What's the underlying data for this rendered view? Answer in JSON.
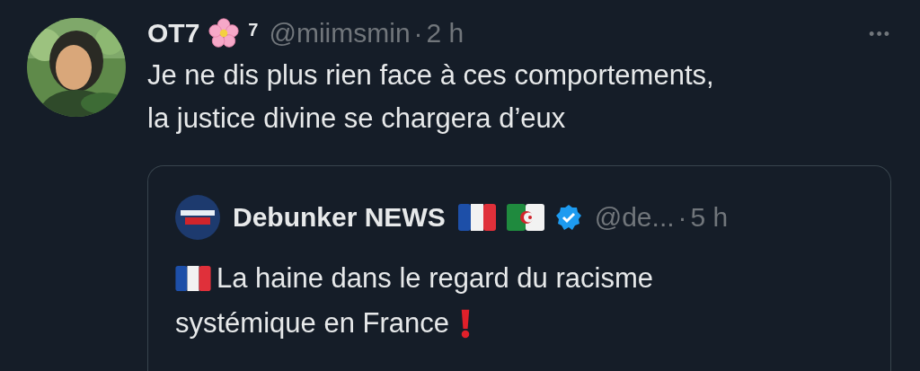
{
  "tweet": {
    "author": {
      "name": "OT7",
      "superscript": "7",
      "handle": "@miimsmin",
      "separator": "·",
      "time": "2 h"
    },
    "more": "•••",
    "text_lines": [
      "Je ne dis plus rien face à ces comportements,",
      "la justice divine se chargera d’eux"
    ],
    "quoted": {
      "author": {
        "name": "Debunker NEWS",
        "verified": true,
        "handle": "@de...",
        "separator": "·",
        "time": "5 h"
      },
      "text_lines": [
        "La haine dans le regard du racisme",
        "systémique en France"
      ]
    }
  }
}
